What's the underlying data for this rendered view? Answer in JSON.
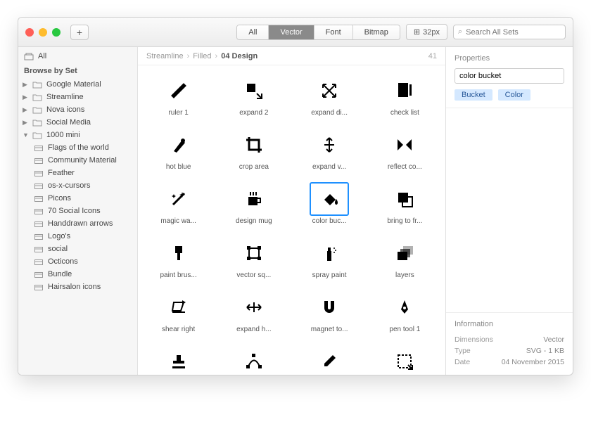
{
  "toolbar": {
    "segments": [
      "All",
      "Vector",
      "Font",
      "Bitmap"
    ],
    "active_segment": 1,
    "size_label": "32px",
    "search_placeholder": "Search All Sets"
  },
  "sidebar": {
    "all_label": "All",
    "browse_header": "Browse by Set",
    "sets": [
      {
        "label": "Google Material",
        "kind": "folder",
        "tri": true
      },
      {
        "label": "Streamline",
        "kind": "folder",
        "tri": true
      },
      {
        "label": "Nova icons",
        "kind": "folder",
        "tri": true
      },
      {
        "label": "Social Media",
        "kind": "folder",
        "tri": true
      },
      {
        "label": "1000 mini",
        "kind": "folder",
        "tri": true,
        "open": true
      }
    ],
    "sub": [
      "Flags of the world",
      "Community Material",
      "Feather",
      "os-x-cursors",
      "Picons",
      "70 Social Icons",
      "Handdrawn arrows",
      "Logo's",
      "social",
      "Octicons",
      "Bundle",
      "Hairsalon icons"
    ]
  },
  "breadcrumb": {
    "parts": [
      "Streamline",
      "Filled",
      "04 Design"
    ],
    "count": "41"
  },
  "icons": [
    {
      "label": "ruler 1",
      "svg": "ruler"
    },
    {
      "label": "expand 2",
      "svg": "expand2"
    },
    {
      "label": "expand di...",
      "svg": "expanddi"
    },
    {
      "label": "check list",
      "svg": "checklist"
    },
    {
      "label": "hot blue",
      "svg": "hotblue"
    },
    {
      "label": "crop area",
      "svg": "crop"
    },
    {
      "label": "expand v...",
      "svg": "expandv"
    },
    {
      "label": "reflect co...",
      "svg": "reflect"
    },
    {
      "label": "magic wa...",
      "svg": "wand"
    },
    {
      "label": "design mug",
      "svg": "mug"
    },
    {
      "label": "color buc...",
      "svg": "bucket",
      "selected": true
    },
    {
      "label": "bring to fr...",
      "svg": "bringfront"
    },
    {
      "label": "paint brus...",
      "svg": "brush"
    },
    {
      "label": "vector sq...",
      "svg": "vectorsq"
    },
    {
      "label": "spray paint",
      "svg": "spray"
    },
    {
      "label": "layers",
      "svg": "layers"
    },
    {
      "label": "shear right",
      "svg": "shear"
    },
    {
      "label": "expand h...",
      "svg": "expandh"
    },
    {
      "label": "magnet to...",
      "svg": "magnet"
    },
    {
      "label": "pen tool 1",
      "svg": "pen"
    },
    {
      "label": "",
      "svg": "stamp"
    },
    {
      "label": "",
      "svg": "vector2"
    },
    {
      "label": "",
      "svg": "dropper"
    },
    {
      "label": "",
      "svg": "dashbox"
    }
  ],
  "properties": {
    "title": "Properties",
    "name_value": "color bucket",
    "tags": [
      "Bucket",
      "Color"
    ]
  },
  "info": {
    "title": "Information",
    "rows": [
      {
        "k": "Dimensions",
        "v": "Vector"
      },
      {
        "k": "Type",
        "v": "SVG - 1 KB"
      },
      {
        "k": "Date",
        "v": "04 November 2015"
      }
    ]
  }
}
